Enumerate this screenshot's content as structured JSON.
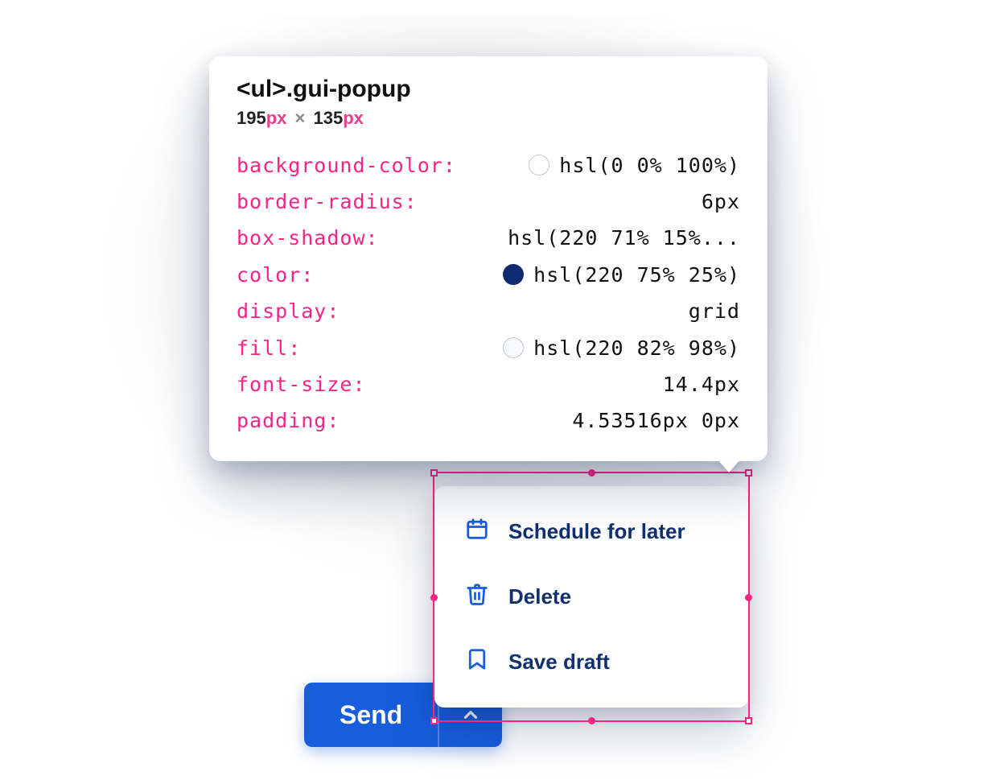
{
  "tooltip": {
    "element_tag": "<ul>",
    "element_class": ".gui-popup",
    "width_num": "195",
    "height_num": "135",
    "px_unit": "px",
    "mult": "×",
    "rows": [
      {
        "prop": "background-color",
        "value": "hsl(0 0% 100%)",
        "swatch": "#ffffff"
      },
      {
        "prop": "border-radius",
        "value": "6px"
      },
      {
        "prop": "box-shadow",
        "value": "hsl(220 71% 15%..."
      },
      {
        "prop": "color",
        "value": "hsl(220 75% 25%)",
        "swatch": "#102a6f",
        "filled": true
      },
      {
        "prop": "display",
        "value": "grid"
      },
      {
        "prop": "fill",
        "value": "hsl(220 82% 98%)",
        "swatch": "#f6f9fe"
      },
      {
        "prop": "font-size",
        "value": "14.4px"
      },
      {
        "prop": "padding",
        "value": "4.53516px 0px"
      }
    ]
  },
  "popup": {
    "items": [
      {
        "icon": "calendar-icon",
        "label": "Schedule for later"
      },
      {
        "icon": "trash-icon",
        "label": "Delete"
      },
      {
        "icon": "bookmark-icon",
        "label": "Save draft"
      }
    ]
  },
  "send_button": {
    "label": "Send"
  },
  "colors": {
    "accent_blue": "#175ddc",
    "select_pink": "#f72585",
    "text_navy": "#11306f"
  }
}
